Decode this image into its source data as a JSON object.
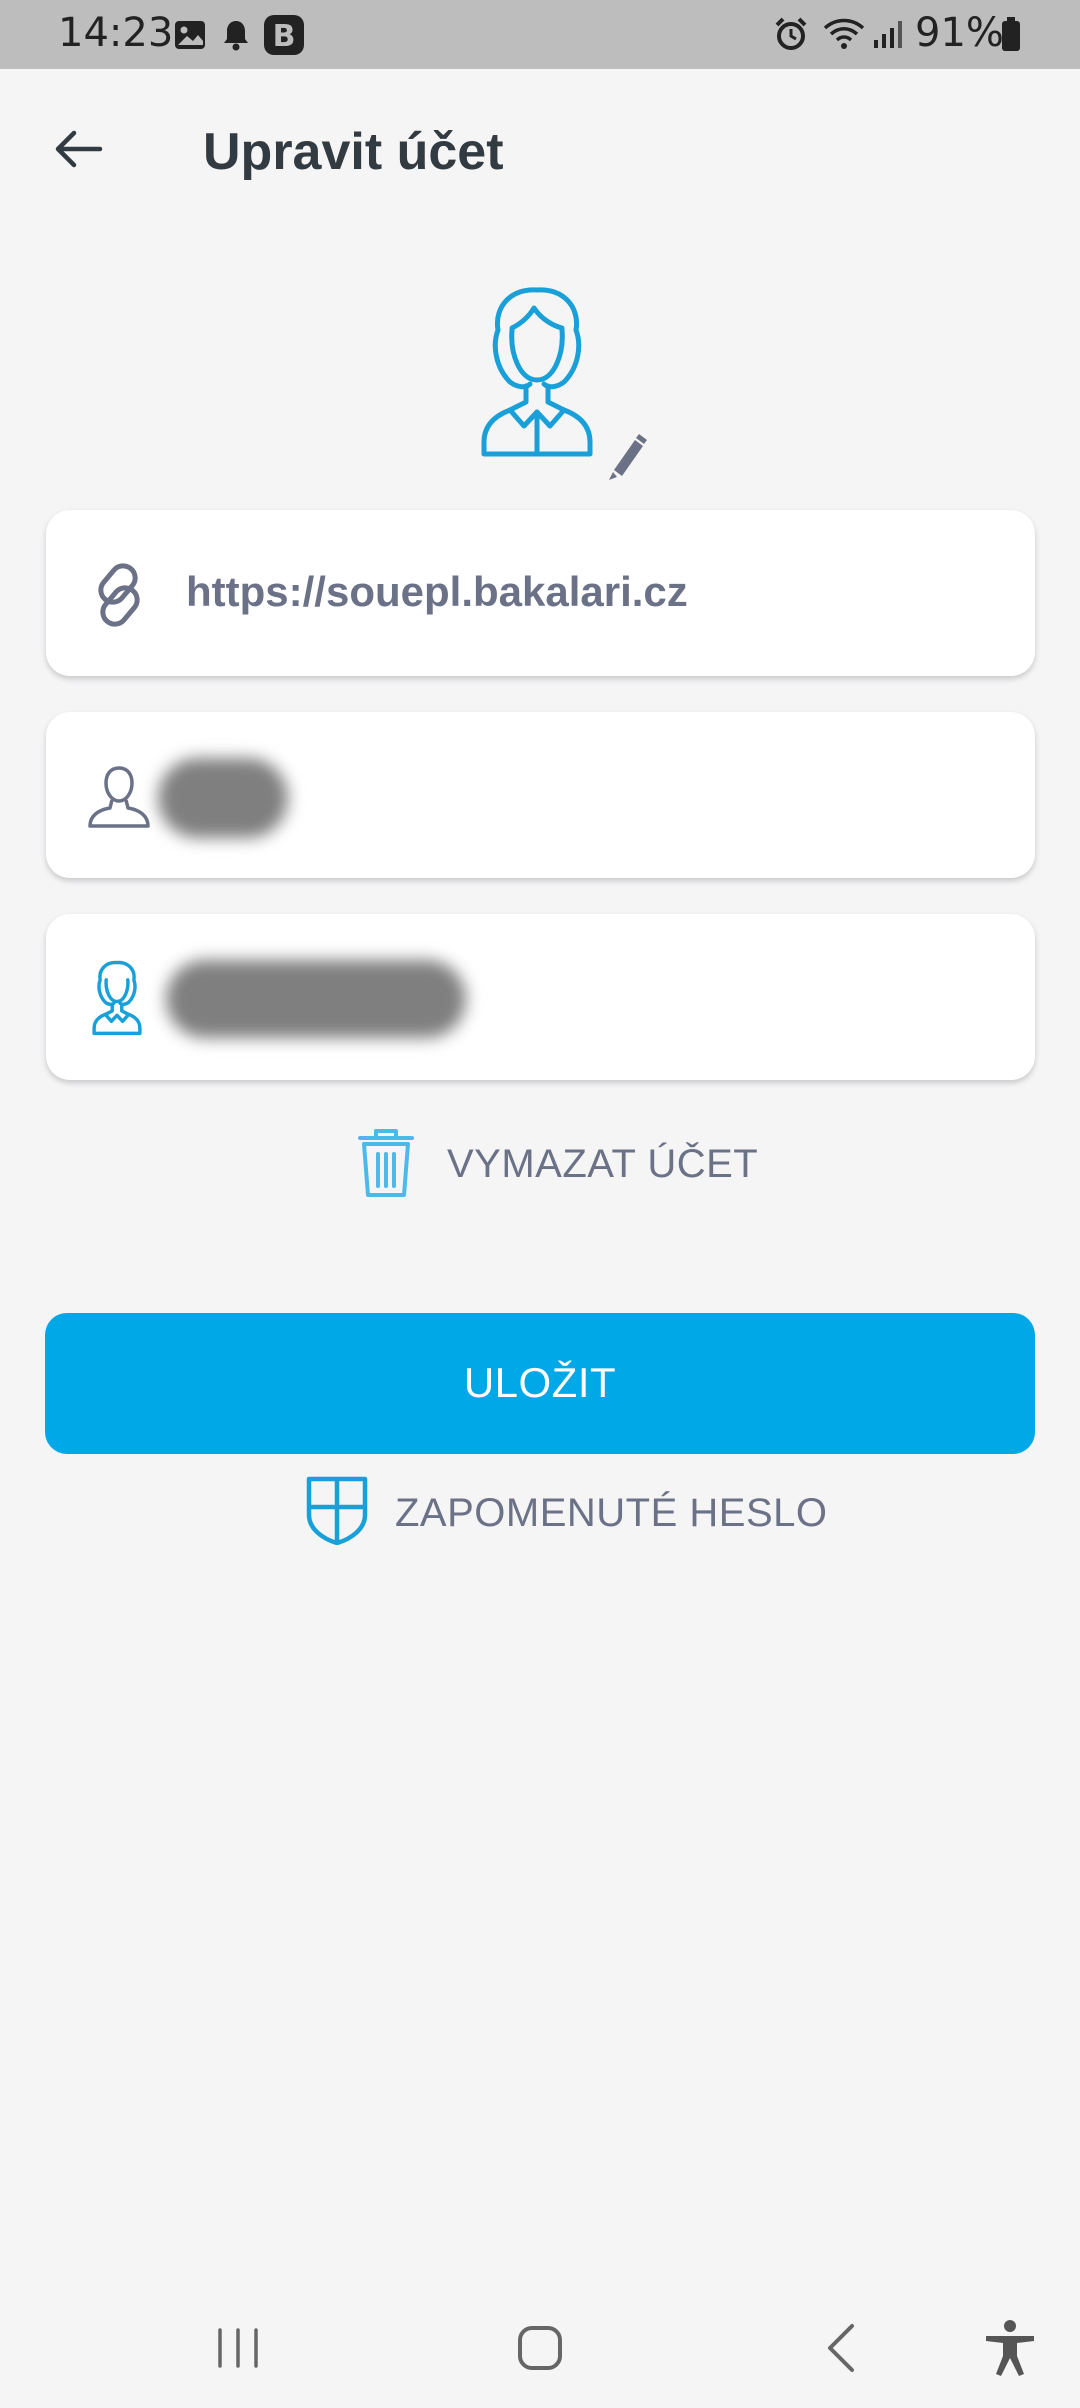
{
  "status_bar": {
    "time": "14:23",
    "battery": "91%",
    "icons": [
      "image-icon",
      "notification-bell-icon",
      "b-app-icon",
      "alarm-icon",
      "wifi-icon",
      "signal-icon",
      "battery-icon"
    ]
  },
  "header": {
    "title": "Upravit účet",
    "back_icon": "arrow-left-icon"
  },
  "avatar": {
    "icon": "female-avatar-icon",
    "edit_icon": "pencil-icon"
  },
  "fields": {
    "server": {
      "value": "https://souepl.bakalari.cz",
      "icon": "link-icon"
    },
    "username": {
      "icon": "user-icon"
    },
    "display_name": {
      "icon": "female-avatar-icon"
    }
  },
  "actions": {
    "delete_label": "VYMAZAT ÚČET",
    "save_label": "ULOŽIT",
    "forgot_label": "ZAPOMENUTÉ HESLO"
  },
  "colors": {
    "accent": "#00a8e8",
    "icon_blue": "#1aa0d8",
    "text_gray": "#6b7287",
    "title_dark": "#333b42"
  },
  "nav_bar": {
    "buttons": [
      "recent-apps-icon",
      "home-icon",
      "back-icon",
      "accessibility-icon"
    ]
  }
}
